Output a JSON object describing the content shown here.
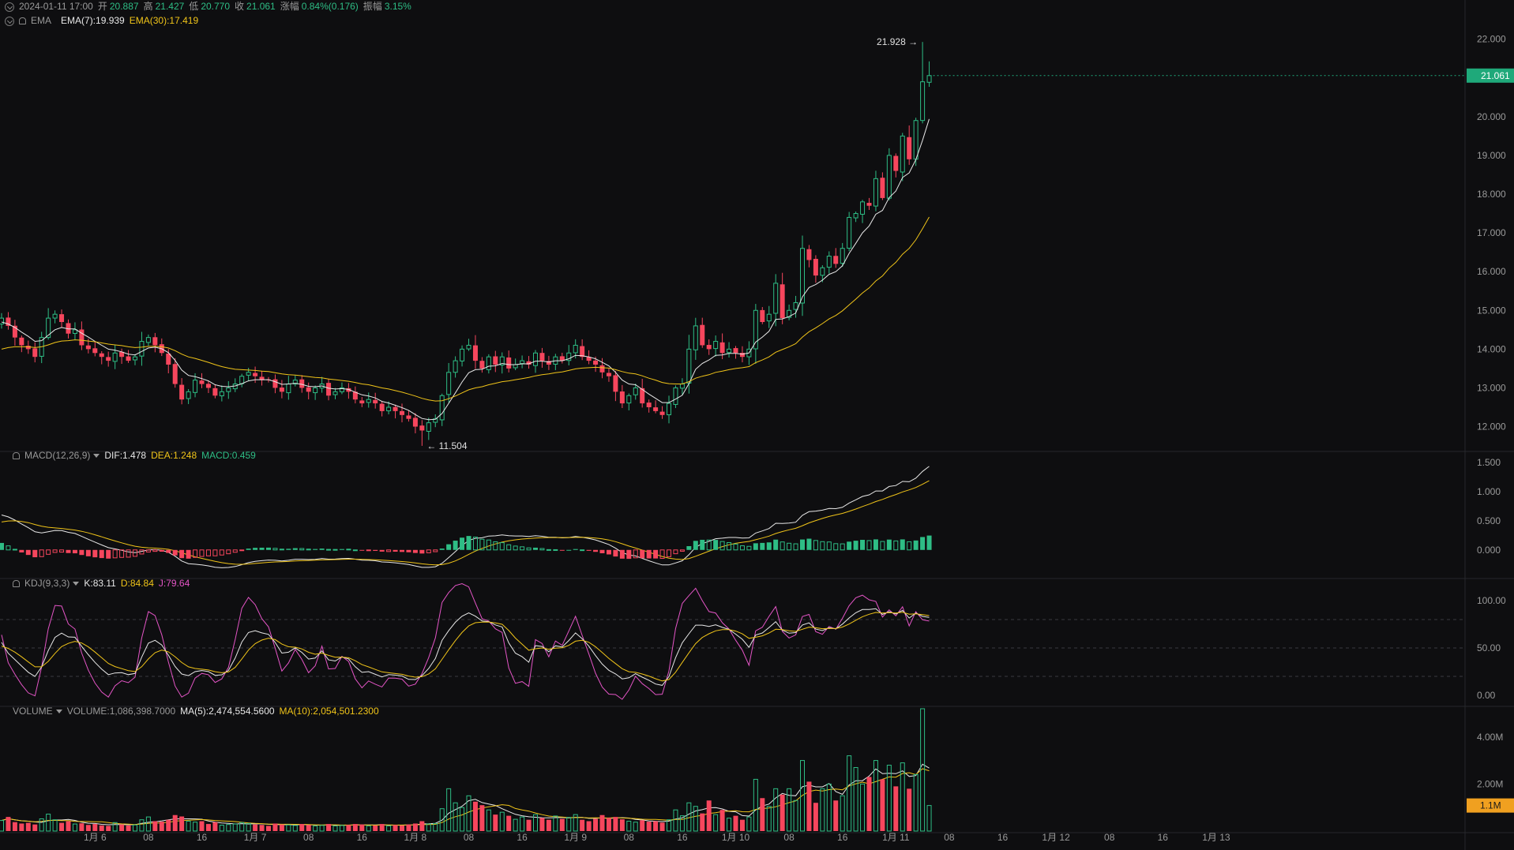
{
  "ohlc_header": {
    "datetime": "2024-01-11 17:00",
    "open_label": "开",
    "open": "20.887",
    "high_label": "高",
    "high": "21.427",
    "low_label": "低",
    "low": "20.770",
    "close_label": "收",
    "close": "21.061",
    "change_label": "涨幅",
    "change": "0.84%(0.176)",
    "amplitude_label": "振幅",
    "amplitude": "3.15%"
  },
  "ema_header": {
    "name": "EMA",
    "ema7": "EMA(7):19.939",
    "ema30": "EMA(30):17.419"
  },
  "macd_header": {
    "name": "MACD(12,26,9)",
    "dif": "DIF:1.478",
    "dea": "DEA:1.248",
    "macd": "MACD:0.459"
  },
  "kdj_header": {
    "name": "KDJ(9,3,3)",
    "k": "K:83.11",
    "d": "D:84.84",
    "j": "J:79.64"
  },
  "volume_header": {
    "name": "VOLUME",
    "volume": "VOLUME:1,086,398.7000",
    "ma5": "MA(5):2,474,554.5600",
    "ma10": "MA(10):2,054,501.2300"
  },
  "colors": {
    "up": "#2ebd85",
    "down": "#f6465d",
    "ema7": "#e8e8e8",
    "ema30": "#f0c419",
    "j": "#e455c6",
    "price_tag": "#1fa97a",
    "volume_tag": "#f0a020"
  },
  "chart_data": {
    "type": "candlestick",
    "price_axis": {
      "ticks": [
        "22.000",
        "21.000",
        "20.000",
        "19.000",
        "18.000",
        "17.000",
        "16.000",
        "15.000",
        "14.000",
        "13.000",
        "12.000"
      ],
      "range": [
        11.4,
        22.4
      ]
    },
    "last_price_label": "21.061",
    "high_marker": "21.928",
    "low_marker": "11.504",
    "macd_axis": {
      "ticks": [
        "1.500",
        "1.000",
        "0.500",
        "0.000"
      ],
      "range": [
        -0.45,
        1.65
      ]
    },
    "kdj_axis": {
      "ticks": [
        "100.00",
        "50.00",
        "0.00"
      ],
      "range": [
        -10,
        120
      ]
    },
    "volume_axis": {
      "ticks": [
        "4.00M",
        "2.00M"
      ],
      "range": [
        0,
        5200000
      ]
    },
    "volume_tag": "1.1M",
    "x_axis": {
      "labels": [
        "1月 6",
        "08",
        "16",
        "1月 7",
        "08",
        "16",
        "1月 8",
        "08",
        "16",
        "1月 9",
        "08",
        "16",
        "1月 10",
        "08",
        "16",
        "1月 11",
        "08",
        "16",
        "1月 12",
        "08",
        "16",
        "1月 13"
      ],
      "label_bar_index": [
        0,
        8,
        16,
        24,
        32,
        40,
        48,
        56,
        64,
        72,
        80,
        88,
        96,
        104,
        112,
        120,
        128,
        136,
        144,
        152,
        160,
        168
      ],
      "first_bar_offset_hours": -14
    },
    "close": [
      14.8,
      14.6,
      14.3,
      14.1,
      14.0,
      13.8,
      14.3,
      14.8,
      14.9,
      14.7,
      14.4,
      14.5,
      14.1,
      14.0,
      13.9,
      13.8,
      13.7,
      13.9,
      13.8,
      13.7,
      13.8,
      14.2,
      14.3,
      14.1,
      13.9,
      13.6,
      13.1,
      12.7,
      12.9,
      13.2,
      13.1,
      13.0,
      12.8,
      12.9,
      13.0,
      13.1,
      13.3,
      13.4,
      13.3,
      13.2,
      13.2,
      13.0,
      12.9,
      13.1,
      13.2,
      13.0,
      12.9,
      13.0,
      13.1,
      12.8,
      12.9,
      13.0,
      12.9,
      12.7,
      12.6,
      12.7,
      12.6,
      12.4,
      12.5,
      12.4,
      12.3,
      12.2,
      12.0,
      11.9,
      12.1,
      12.2,
      12.8,
      13.4,
      13.7,
      14.0,
      14.1,
      13.7,
      13.5,
      13.8,
      13.6,
      13.8,
      13.5,
      13.6,
      13.7,
      13.6,
      13.9,
      13.7,
      13.6,
      13.8,
      13.7,
      13.9,
      14.1,
      13.8,
      13.7,
      13.6,
      13.4,
      13.3,
      12.9,
      12.6,
      12.8,
      13.0,
      12.6,
      12.5,
      12.4,
      12.3,
      12.6,
      13.0,
      13.1,
      14.0,
      14.6,
      14.1,
      14.0,
      14.2,
      13.9,
      14.0,
      13.9,
      13.8,
      14.0,
      15.0,
      14.7,
      14.9,
      15.7,
      14.8,
      15.0,
      15.2,
      16.6,
      16.3,
      15.9,
      16.1,
      16.4,
      16.2,
      16.6,
      17.4,
      17.5,
      17.8,
      17.7,
      18.4,
      17.9,
      19.0,
      18.6,
      19.5,
      18.9,
      19.9,
      20.9,
      21.06
    ],
    "ema7": [
      14.7,
      14.65,
      14.56,
      14.44,
      14.33,
      14.2,
      14.22,
      14.36,
      14.5,
      14.56,
      14.52,
      14.52,
      14.41,
      14.31,
      14.2,
      14.1,
      14.0,
      13.97,
      13.93,
      13.87,
      13.85,
      13.94,
      14.03,
      14.05,
      14.01,
      13.91,
      13.71,
      13.46,
      13.32,
      13.29,
      13.24,
      13.18,
      13.08,
      13.04,
      13.03,
      13.05,
      13.11,
      13.18,
      13.21,
      13.21,
      13.21,
      13.16,
      13.09,
      13.1,
      13.12,
      13.09,
      13.04,
      13.03,
      13.05,
      12.99,
      12.97,
      12.98,
      12.96,
      12.89,
      12.82,
      12.79,
      12.74,
      12.65,
      12.61,
      12.55,
      12.49,
      12.42,
      12.31,
      12.21,
      12.18,
      12.19,
      12.34,
      12.6,
      12.87,
      13.15,
      13.39,
      13.47,
      13.48,
      13.56,
      13.57,
      13.63,
      13.6,
      13.6,
      13.62,
      13.62,
      13.69,
      13.69,
      13.67,
      13.7,
      13.7,
      13.75,
      13.84,
      13.83,
      13.8,
      13.75,
      13.66,
      13.57,
      13.4,
      13.2,
      13.1,
      13.08,
      12.96,
      12.84,
      12.73,
      12.62,
      12.62,
      12.71,
      12.81,
      13.11,
      13.48,
      13.63,
      13.72,
      13.84,
      13.85,
      13.89,
      13.89,
      13.87,
      13.9,
      14.18,
      14.31,
      14.46,
      14.77,
      14.78,
      14.84,
      14.93,
      15.35,
      15.59,
      15.67,
      15.78,
      15.93,
      16.0,
      16.15,
      16.47,
      16.73,
      17.0,
      17.18,
      17.48,
      17.58,
      17.91,
      18.08,
      18.43,
      18.55,
      18.89,
      19.39,
      19.94
    ],
    "ema30": [
      14.0,
      14.04,
      14.06,
      14.06,
      14.06,
      14.04,
      14.06,
      14.11,
      14.17,
      14.21,
      14.22,
      14.24,
      14.23,
      14.21,
      14.19,
      14.16,
      14.13,
      14.11,
      14.09,
      14.06,
      14.04,
      14.05,
      14.07,
      14.07,
      14.06,
      14.03,
      13.96,
      13.87,
      13.8,
      13.76,
      13.71,
      13.66,
      13.6,
      13.55,
      13.51,
      13.48,
      13.47,
      13.46,
      13.45,
      13.43,
      13.42,
      13.39,
      13.36,
      13.34,
      13.33,
      13.31,
      13.29,
      13.27,
      13.26,
      13.23,
      13.21,
      13.19,
      13.17,
      13.14,
      13.1,
      13.08,
      13.04,
      13.0,
      12.97,
      12.93,
      12.89,
      12.84,
      12.79,
      12.73,
      12.69,
      12.66,
      12.67,
      12.72,
      12.79,
      12.87,
      12.95,
      13.0,
      13.03,
      13.08,
      13.12,
      13.16,
      13.18,
      13.21,
      13.24,
      13.27,
      13.31,
      13.34,
      13.36,
      13.39,
      13.41,
      13.45,
      13.49,
      13.51,
      13.52,
      13.53,
      13.52,
      13.51,
      13.47,
      13.42,
      13.38,
      13.36,
      13.31,
      13.25,
      13.2,
      13.14,
      13.11,
      13.1,
      13.1,
      13.16,
      13.25,
      13.3,
      13.34,
      13.4,
      13.43,
      13.47,
      13.5,
      13.52,
      13.55,
      13.65,
      13.72,
      13.8,
      13.92,
      13.99,
      14.06,
      14.14,
      14.31,
      14.45,
      14.55,
      14.66,
      14.78,
      14.87,
      14.99,
      15.14,
      15.29,
      15.45,
      15.58,
      15.76,
      15.89,
      16.09,
      16.24,
      16.45,
      16.6,
      16.82,
      17.11,
      17.41
    ],
    "volume": [
      450000,
      600000,
      380000,
      320000,
      350000,
      280000,
      520000,
      720000,
      480000,
      350000,
      420000,
      300000,
      330000,
      260000,
      300000,
      240000,
      220000,
      360000,
      280000,
      240000,
      260000,
      480000,
      600000,
      420000,
      400000,
      480000,
      680000,
      620000,
      420000,
      380000,
      420000,
      300000,
      380000,
      250000,
      280000,
      300000,
      360000,
      320000,
      280000,
      260000,
      220000,
      320000,
      280000,
      260000,
      240000,
      300000,
      260000,
      220000,
      240000,
      300000,
      220000,
      240000,
      260000,
      300000,
      280000,
      220000,
      240000,
      300000,
      220000,
      260000,
      240000,
      280000,
      320000,
      420000,
      300000,
      320000,
      950000,
      1800000,
      1200000,
      1000000,
      1500000,
      1250000,
      1100000,
      900000,
      700000,
      800000,
      650000,
      500000,
      600000,
      480000,
      700000,
      560000,
      480000,
      640000,
      520000,
      580000,
      700000,
      480000,
      420000,
      520000,
      680000,
      560000,
      600000,
      500000,
      420000,
      380000,
      460000,
      400000,
      420000,
      360000,
      480000,
      900000,
      650000,
      1200000,
      1050000,
      750000,
      1300000,
      700000,
      900000,
      550000,
      650000,
      480000,
      600000,
      2200000,
      1400000,
      1050000,
      1800000,
      1550000,
      1800000,
      1300000,
      3000000,
      2100000,
      1200000,
      1800000,
      2000000,
      1300000,
      1500000,
      3200000,
      2700000,
      2000000,
      2300000,
      3000000,
      2200000,
      2800000,
      1900000,
      2900000,
      1800000,
      2400000,
      5200000,
      1086398
    ]
  }
}
